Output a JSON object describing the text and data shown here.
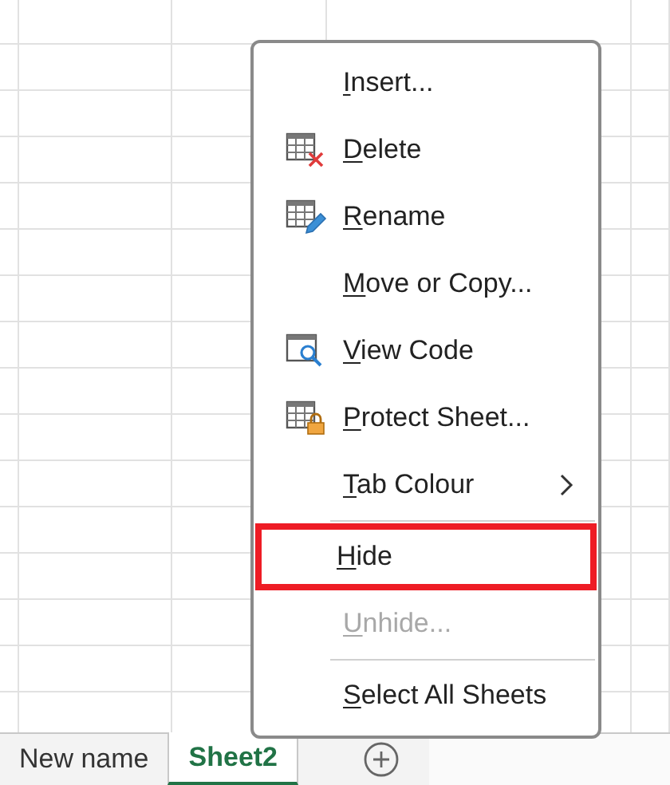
{
  "sheet_tabs": [
    {
      "label": "New name",
      "selected": false
    },
    {
      "label": "Sheet2",
      "selected": true
    }
  ],
  "context_menu": {
    "items": [
      {
        "label": "Insert...",
        "kind": "plain",
        "mnemonic": true,
        "disabled": false,
        "submenu": false,
        "separator_before": false,
        "highlighted": false
      },
      {
        "label": "Delete",
        "kind": "delete",
        "mnemonic": true,
        "disabled": false,
        "submenu": false,
        "separator_before": false,
        "highlighted": false
      },
      {
        "label": "Rename",
        "kind": "rename",
        "mnemonic": true,
        "disabled": false,
        "submenu": false,
        "separator_before": false,
        "highlighted": false
      },
      {
        "label": "Move or Copy...",
        "kind": "plain",
        "mnemonic": true,
        "disabled": false,
        "submenu": false,
        "separator_before": false,
        "highlighted": false
      },
      {
        "label": "View Code",
        "kind": "view-code",
        "mnemonic": true,
        "disabled": false,
        "submenu": false,
        "separator_before": false,
        "highlighted": false
      },
      {
        "label": "Protect Sheet...",
        "kind": "protect",
        "mnemonic": true,
        "disabled": false,
        "submenu": false,
        "separator_before": false,
        "highlighted": false
      },
      {
        "label": "Tab Colour",
        "kind": "plain",
        "mnemonic": true,
        "disabled": false,
        "submenu": true,
        "separator_before": false,
        "highlighted": false
      },
      {
        "label": "Hide",
        "kind": "plain",
        "mnemonic": true,
        "disabled": false,
        "submenu": false,
        "separator_before": true,
        "highlighted": true
      },
      {
        "label": "Unhide...",
        "kind": "plain",
        "mnemonic": true,
        "disabled": true,
        "submenu": false,
        "separator_before": false,
        "highlighted": false
      },
      {
        "label": "Select All Sheets",
        "kind": "plain",
        "mnemonic": true,
        "disabled": false,
        "submenu": false,
        "separator_before": true,
        "highlighted": false
      }
    ]
  }
}
